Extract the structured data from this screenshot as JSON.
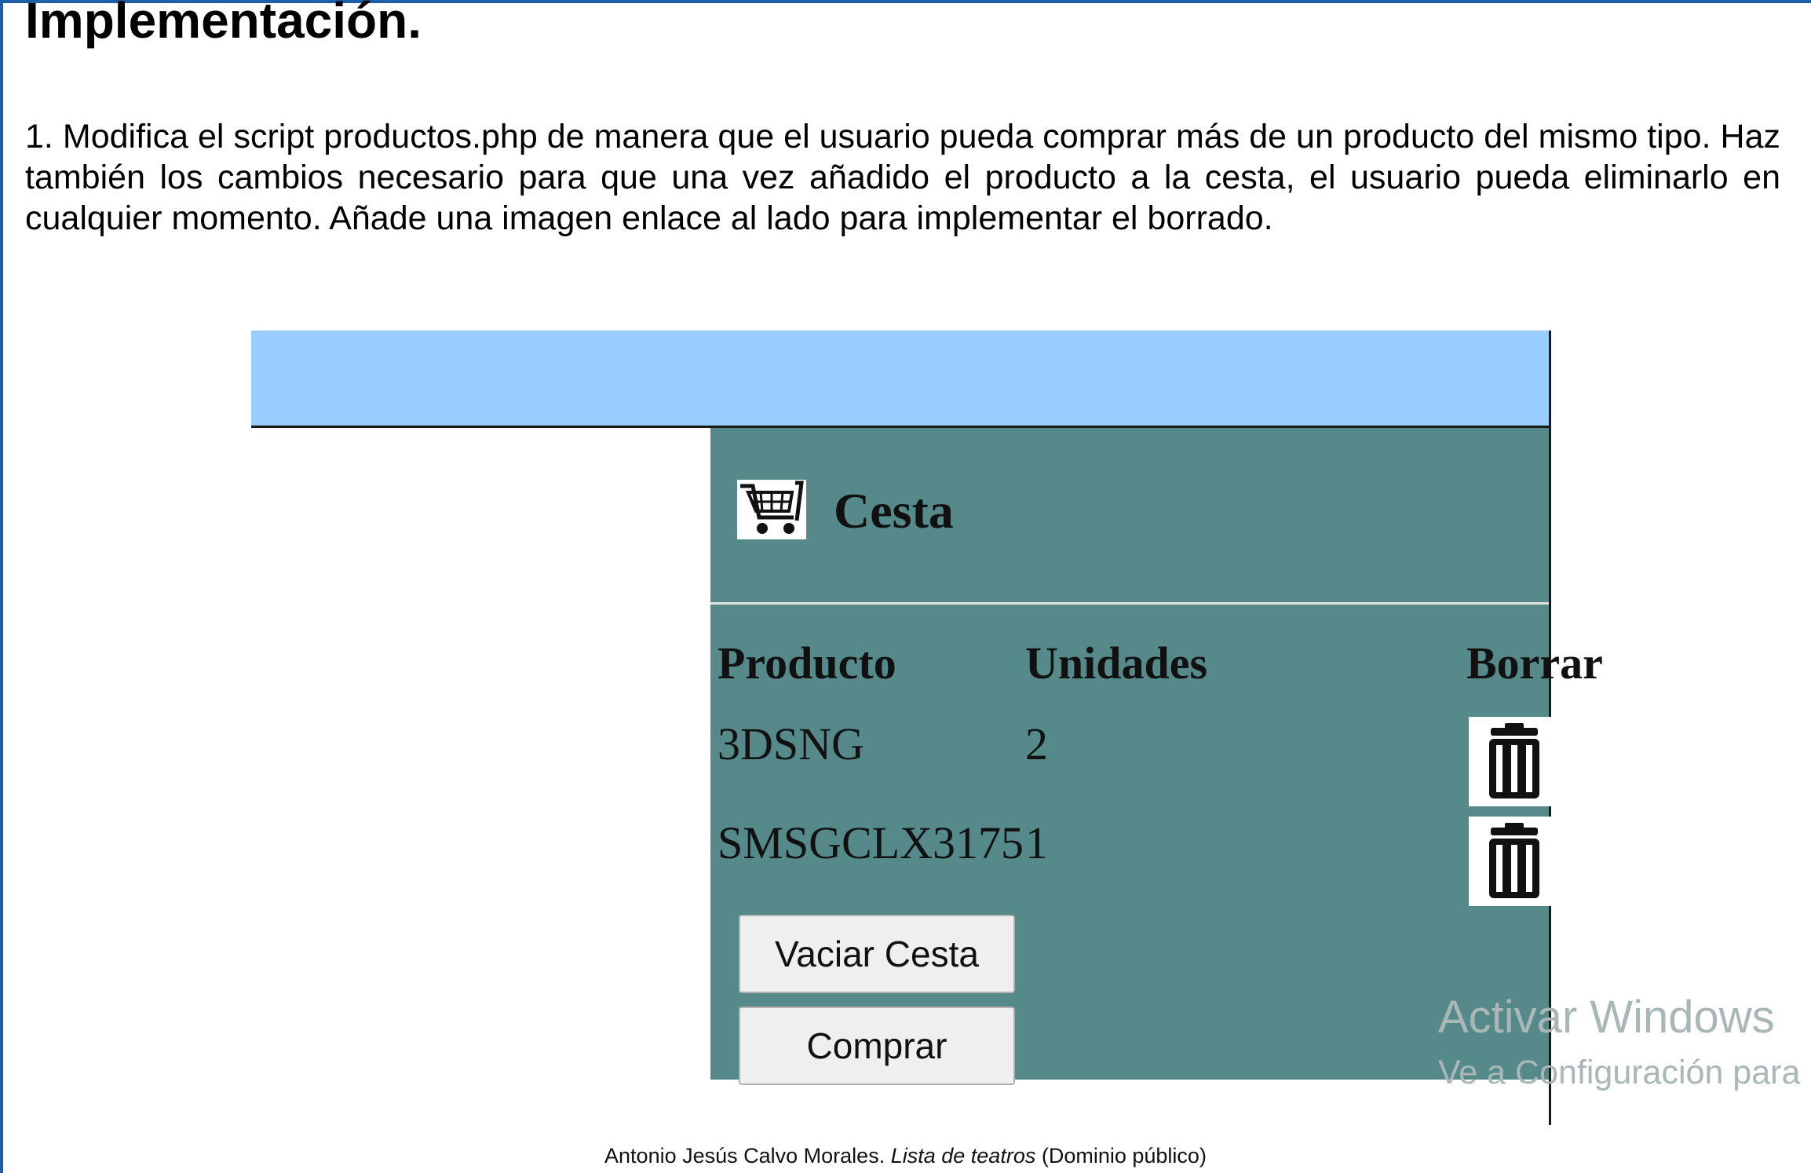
{
  "page": {
    "heading": "Implementación.",
    "paragraph": "1. Modifica el script productos.php de manera que el usuario pueda comprar más de un producto del mismo tipo. Haz también los cambios necesario para que una vez añadido el producto a la cesta, el usuario pueda eliminarlo en cualquier momento. Añade una imagen enlace al lado para implementar el borrado."
  },
  "cart": {
    "title": "Cesta",
    "icon": "shopping-cart-icon",
    "columns": {
      "product": "Producto",
      "units": "Unidades",
      "delete": "Borrar"
    },
    "rows": [
      {
        "product": "3DSNG",
        "units": "2",
        "delete_icon": "trash-icon"
      },
      {
        "product": "SMSGCLX3175",
        "units": "1",
        "delete_icon": "trash-icon"
      }
    ],
    "buttons": {
      "empty": "Vaciar Cesta",
      "buy": "Comprar"
    }
  },
  "watermark": {
    "line1": "Activar Windows",
    "line2": "Ve a Configuración para"
  },
  "caption": {
    "author": "Antonio Jesús Calvo Morales.",
    "title": "Lista de teatros",
    "license": "(Dominio público)"
  },
  "colors": {
    "banner": "#99ccff",
    "panel": "#568a8a",
    "frame": "#1f5fa8"
  }
}
